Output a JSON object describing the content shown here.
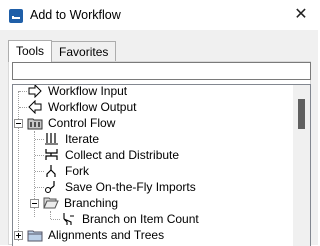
{
  "window": {
    "title": "Add to Workflow",
    "close_glyph": "✕"
  },
  "tabs": [
    {
      "label": "Tools"
    },
    {
      "label": "Favorites"
    }
  ],
  "filter": {
    "value": "",
    "placeholder": ""
  },
  "tree": {
    "items": [
      {
        "label": "Workflow Input",
        "icon": "arrow-right-outline-icon"
      },
      {
        "label": "Workflow Output",
        "icon": "arrow-left-outline-icon"
      },
      {
        "label": "Control Flow",
        "icon": "control-flow-folder-icon",
        "expanded": true
      },
      {
        "label": "Iterate",
        "icon": "iterate-icon"
      },
      {
        "label": "Collect and Distribute",
        "icon": "collect-distribute-icon"
      },
      {
        "label": "Fork",
        "icon": "fork-icon"
      },
      {
        "label": "Save On-the-Fly Imports",
        "icon": "save-imports-icon"
      },
      {
        "label": "Branching",
        "icon": "folder-open-icon",
        "expanded": true
      },
      {
        "label": "Branch on Item Count",
        "icon": "branch-icon"
      },
      {
        "label": "Alignments and Trees",
        "icon": "folder-closed-icon",
        "expanded": false
      }
    ]
  }
}
